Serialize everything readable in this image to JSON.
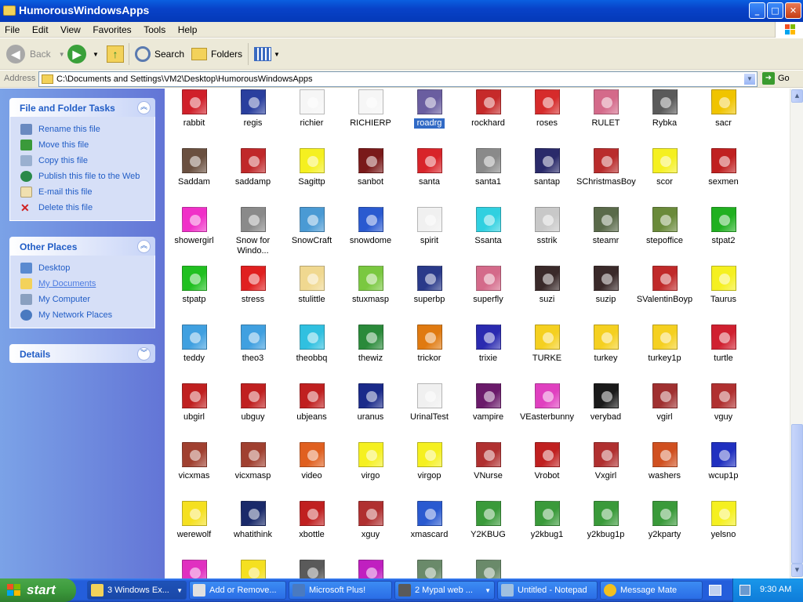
{
  "window": {
    "title": "HumorousWindowsApps",
    "buttons": {
      "minimize": "_",
      "maximize": "□",
      "close": "✕"
    }
  },
  "menu": [
    "File",
    "Edit",
    "View",
    "Favorites",
    "Tools",
    "Help"
  ],
  "toolbar": {
    "back": "Back",
    "search": "Search",
    "folders": "Folders"
  },
  "address": {
    "label": "Address",
    "path": "C:\\Documents and Settings\\VM2\\Desktop\\HumorousWindowsApps",
    "go": "Go"
  },
  "panels": {
    "tasks": {
      "title": "File and Folder Tasks",
      "items": [
        "Rename this file",
        "Move this file",
        "Copy this file",
        "Publish this file to the Web",
        "E-mail this file",
        "Delete this file"
      ]
    },
    "places": {
      "title": "Other Places",
      "items": [
        "Desktop",
        "My Documents",
        "My Computer",
        "My Network Places"
      ]
    },
    "details": {
      "title": "Details"
    }
  },
  "colors": {
    "selection": "#316ac5",
    "task_blue": "#215dc6",
    "sidebar": "#7ba2e7"
  },
  "files": [
    {
      "label": "rabbit",
      "color": "#d0202a",
      "icon": "rabbit-icon"
    },
    {
      "label": "regis",
      "color": "#2a3f9e",
      "icon": "face-icon"
    },
    {
      "label": "richier",
      "color": "#f6f6f6",
      "icon": "cartoon-face-icon"
    },
    {
      "label": "RICHIERP",
      "color": "#f6f6f6",
      "icon": "cartoon-face-icon"
    },
    {
      "label": "roadrg",
      "color": "#6a5ea0",
      "icon": "car-icon"
    },
    {
      "label": "rockhard",
      "color": "#c62a2a",
      "icon": "guitar-icon"
    },
    {
      "label": "roses",
      "color": "#d62b2b",
      "icon": "roses-icon"
    },
    {
      "label": "RULET",
      "color": "#d46a8a",
      "icon": "diamond-icon"
    },
    {
      "label": "Rybka",
      "color": "#5a5a5a",
      "icon": "projector-icon"
    },
    {
      "label": "sacr",
      "color": "#f0c400",
      "icon": "halo-icon"
    },
    {
      "label": "Saddam",
      "color": "#6a5040",
      "icon": "face-icon"
    },
    {
      "label": "saddamp",
      "color": "#c0282a",
      "icon": "face-icon"
    },
    {
      "label": "Sagittp",
      "color": "#f5f020",
      "icon": "zodiac-icon"
    },
    {
      "label": "sanbot",
      "color": "#7a1a1a",
      "icon": "robot-icon"
    },
    {
      "label": "santa",
      "color": "#d8242a",
      "icon": "santa-icon"
    },
    {
      "label": "santa1",
      "color": "#8a8a8a",
      "icon": "mouse-icon"
    },
    {
      "label": "santap",
      "color": "#2a2a6a",
      "icon": "chimney-icon"
    },
    {
      "label": "SChristmasBoy",
      "color": "#b92c2c",
      "icon": "face-icon"
    },
    {
      "label": "scor",
      "color": "#f5f020",
      "icon": "zodiac-icon"
    },
    {
      "label": "sexmen",
      "color": "#c02020",
      "icon": "flag-icon"
    },
    {
      "label": "showergirl",
      "color": "#f030c8",
      "icon": "curtain-icon"
    },
    {
      "label": "Snow for Windo...",
      "color": "#8a8a8a",
      "icon": "snow-icon"
    },
    {
      "label": "SnowCraft",
      "color": "#4a9ad4",
      "icon": "projector-icon"
    },
    {
      "label": "snowdome",
      "color": "#2a5ad0",
      "icon": "snowdome-icon"
    },
    {
      "label": "spirit",
      "color": "#f0f0f0",
      "icon": "snowman-icon"
    },
    {
      "label": "Ssanta",
      "color": "#30d0e0",
      "icon": "face-icon"
    },
    {
      "label": "sstrik",
      "color": "#c8c8c8",
      "icon": "rabbit-icon"
    },
    {
      "label": "steamr",
      "color": "#5a6a4a",
      "icon": "train-icon"
    },
    {
      "label": "stepoffice",
      "color": "#6a8a3a",
      "icon": "zombie-icon"
    },
    {
      "label": "stpat2",
      "color": "#20b020",
      "icon": "clover-icon"
    },
    {
      "label": "stpatp",
      "color": "#20c020",
      "icon": "clover-icon"
    },
    {
      "label": "stress",
      "color": "#e02020",
      "icon": "face-icon"
    },
    {
      "label": "stulittle",
      "color": "#f0d890",
      "icon": "mouse-icon"
    },
    {
      "label": "stuxmasp",
      "color": "#7ac840",
      "icon": "face-icon"
    },
    {
      "label": "superbp",
      "color": "#2a3a8a",
      "icon": "helmet-icon"
    },
    {
      "label": "superfly",
      "color": "#d46a8a",
      "icon": "diamond-icon"
    },
    {
      "label": "suzi",
      "color": "#3a2a2a",
      "icon": "face-icon"
    },
    {
      "label": "suzip",
      "color": "#3a2a2a",
      "icon": "face-icon"
    },
    {
      "label": "SValentinBoyp",
      "color": "#c02a2a",
      "icon": "face-icon"
    },
    {
      "label": "Taurus",
      "color": "#f5f020",
      "icon": "zodiac-icon"
    },
    {
      "label": "teddy",
      "color": "#40a0e0",
      "icon": "bear-icon"
    },
    {
      "label": "theo3",
      "color": "#40a0e0",
      "icon": "bear-icon"
    },
    {
      "label": "theobbq",
      "color": "#30c0e0",
      "icon": "chef-icon"
    },
    {
      "label": "thewiz",
      "color": "#2a8a3a",
      "icon": "wizard-icon"
    },
    {
      "label": "trickor",
      "color": "#e07a10",
      "icon": "pumpkin-icon"
    },
    {
      "label": "trixie",
      "color": "#2a2ab0",
      "icon": "hat-icon"
    },
    {
      "label": "TURKE",
      "color": "#f5d020",
      "icon": "turkey-icon"
    },
    {
      "label": "turkey",
      "color": "#f5d020",
      "icon": "turkey-icon"
    },
    {
      "label": "turkey1p",
      "color": "#f5d020",
      "icon": "turkey-icon"
    },
    {
      "label": "turtle",
      "color": "#d02030",
      "icon": "heart-icon"
    },
    {
      "label": "ubgirl",
      "color": "#c02020",
      "icon": "ub-icon"
    },
    {
      "label": "ubguy",
      "color": "#c02020",
      "icon": "ub-icon"
    },
    {
      "label": "ubjeans",
      "color": "#c02020",
      "icon": "ub-icon"
    },
    {
      "label": "uranus",
      "color": "#1a2a8a",
      "icon": "telescope-icon"
    },
    {
      "label": "UrinalTest",
      "color": "#f0f0f0",
      "icon": "projector-icon"
    },
    {
      "label": "vampire",
      "color": "#6a1a6a",
      "icon": "bat-icon"
    },
    {
      "label": "VEasterbunny",
      "color": "#e040c0",
      "icon": "bunny-icon"
    },
    {
      "label": "verybad",
      "color": "#1a1a1a",
      "icon": "spring-icon"
    },
    {
      "label": "vgirl",
      "color": "#a03030",
      "icon": "face-icon"
    },
    {
      "label": "vguy",
      "color": "#b03030",
      "icon": "face-icon"
    },
    {
      "label": "vicxmas",
      "color": "#a04030",
      "icon": "face-icon"
    },
    {
      "label": "vicxmasp",
      "color": "#a04030",
      "icon": "face-icon"
    },
    {
      "label": "video",
      "color": "#e06020",
      "icon": "face-icon"
    },
    {
      "label": "virgo",
      "color": "#f5f020",
      "icon": "zodiac-icon"
    },
    {
      "label": "virgop",
      "color": "#f5f020",
      "icon": "zodiac-icon"
    },
    {
      "label": "VNurse",
      "color": "#b03030",
      "icon": "face-icon"
    },
    {
      "label": "Vrobot",
      "color": "#c02020",
      "icon": "heart-icon"
    },
    {
      "label": "Vxgirl",
      "color": "#b03030",
      "icon": "face-icon"
    },
    {
      "label": "washers",
      "color": "#d05020",
      "icon": "washer-icon"
    },
    {
      "label": "wcup1p",
      "color": "#2030c0",
      "icon": "flag-icon"
    },
    {
      "label": "werewolf",
      "color": "#f5e020",
      "icon": "pacman-icon"
    },
    {
      "label": "whatithink",
      "color": "#1a2a6a",
      "icon": "magnifier-icon"
    },
    {
      "label": "xbottle",
      "color": "#c02020",
      "icon": "bottle-icon"
    },
    {
      "label": "xguy",
      "color": "#b03030",
      "icon": "face-icon"
    },
    {
      "label": "xmascard",
      "color": "#2a5ad0",
      "icon": "snowdome-icon"
    },
    {
      "label": "Y2KBUG",
      "color": "#3a9a3a",
      "icon": "bug-icon"
    },
    {
      "label": "y2kbug1",
      "color": "#3a9a3a",
      "icon": "bug-icon"
    },
    {
      "label": "y2kbug1p",
      "color": "#3a9a3a",
      "icon": "bug-icon"
    },
    {
      "label": "y2kparty",
      "color": "#3a9a3a",
      "icon": "glass-icon"
    },
    {
      "label": "yelsno",
      "color": "#f5f020",
      "icon": "radiation-icon"
    },
    {
      "label": "",
      "color": "#e030c0",
      "icon": "curtain-icon"
    },
    {
      "label": "",
      "color": "#f5e020",
      "icon": "face-icon"
    },
    {
      "label": "",
      "color": "#5a5a5a",
      "icon": "projector-icon"
    },
    {
      "label": "",
      "color": "#c020c0",
      "icon": "bomb-icon"
    },
    {
      "label": "",
      "color": "#6a8a6a",
      "icon": "zombie-icon"
    },
    {
      "label": "",
      "color": "#6a8a6a",
      "icon": "zombie-icon"
    }
  ],
  "taskbar": {
    "start": "start",
    "tasks": [
      "3 Windows Ex...",
      "Add or Remove...",
      "Microsoft Plus!",
      "2 Mypal web ...",
      "Untitled - Notepad",
      "Message Mate"
    ],
    "clock": "9:30 AM"
  }
}
